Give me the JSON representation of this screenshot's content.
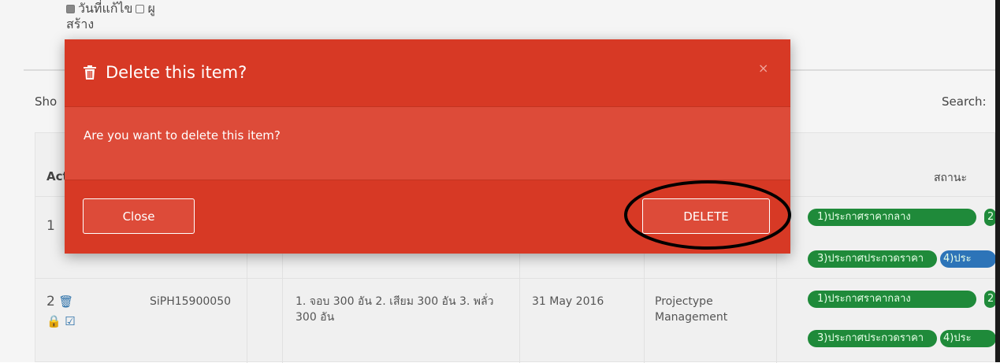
{
  "background": {
    "filter": {
      "line1": "วันที่แก้ไข",
      "line1_b": "ผู",
      "line2": "สร้าง"
    },
    "show_label": "Sho",
    "search_label": "Search:",
    "table": {
      "col_action_header": "Act",
      "col_status_header": "สถานะ",
      "rows": [
        {
          "num": "1",
          "code": "",
          "description": "",
          "date": "",
          "type": "",
          "status_pills": [
            "1)ประกาศราคากลาง",
            "2",
            "3)ประกาศประกวดราคา",
            "4)ประ"
          ]
        },
        {
          "num": "2",
          "code": "SiPH15900050",
          "description": "1. จอบ 300 อัน 2. เสียม 300 อัน 3. พลั่ว 300 อัน",
          "date": "31 May 2016",
          "type": "Projectype Management",
          "status_pills": [
            "1)ประกาศราคากลาง",
            "2",
            "3)ประกาศประกวดราคา",
            "4)ประ"
          ]
        }
      ]
    }
  },
  "modal": {
    "title": "Delete this item?",
    "close_x": "×",
    "body": "Are you want to delete this item?",
    "close_button": "Close",
    "delete_button": "DELETE"
  },
  "colors": {
    "modal_bg": "#dd4b39",
    "modal_header": "#d73925",
    "pill_green": "#1f8a3a",
    "pill_blue": "#2d74b8"
  }
}
